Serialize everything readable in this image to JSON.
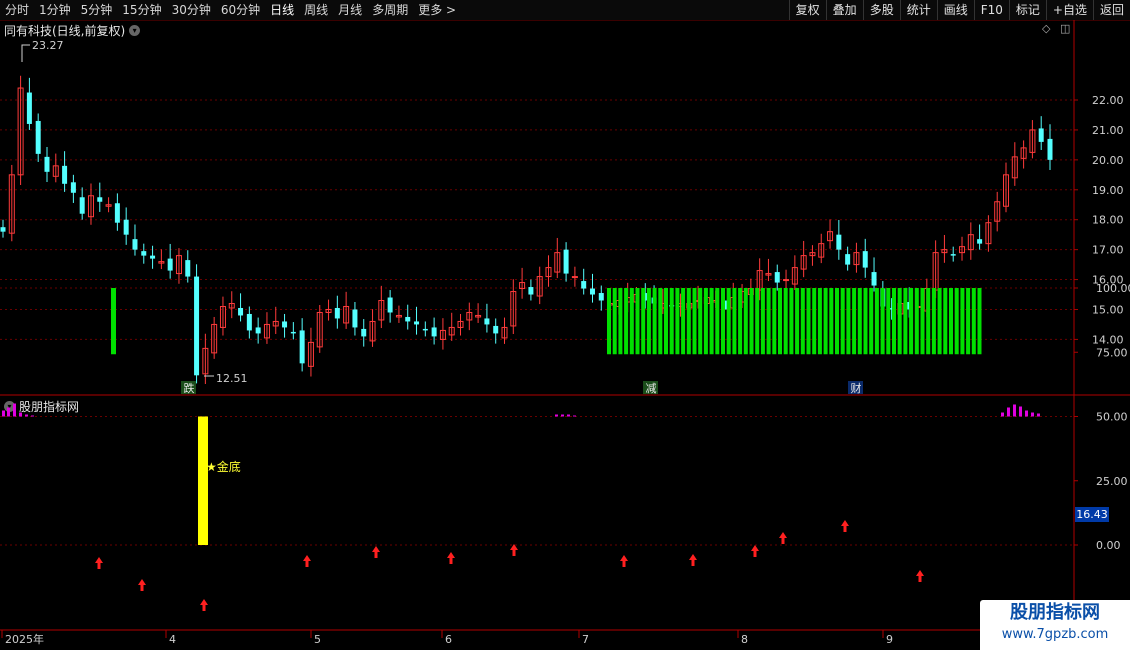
{
  "toolbar": {
    "periods": [
      "分时",
      "1分钟",
      "5分钟",
      "15分钟",
      "30分钟",
      "60分钟",
      "日线",
      "周线",
      "月线",
      "多周期",
      "更多 >"
    ],
    "active_period": "日线",
    "tools": [
      "复权",
      "叠加",
      "多股",
      "统计",
      "画线",
      "F10",
      "标记",
      "+自选",
      "返回"
    ]
  },
  "main_panel": {
    "title": "同有科技(日线,前复权)",
    "high_label": "23.27",
    "low_label": "12.51",
    "markers": [
      "跌",
      "减",
      "财"
    ]
  },
  "indicator_panel": {
    "title": "股朋指标网",
    "signal_label": "★金底",
    "current_value": "16.43"
  },
  "watermark": {
    "line1": "股朋指标网",
    "line2": "www.7gpzb.com"
  },
  "chart_data": [
    {
      "type": "candlestick",
      "title": "同有科技(日线,前复权)",
      "y_ticks": [
        14.0,
        15.0,
        16.0,
        17.0,
        18.0,
        19.0,
        20.0,
        21.0,
        22.0
      ],
      "ylim": [
        12.0,
        23.5
      ],
      "x_ticks": [
        "2025年",
        "4",
        "5",
        "6",
        "7",
        "8",
        "9"
      ],
      "grid": true,
      "annotations": {
        "max": 23.27,
        "min": 12.51
      },
      "close": [
        17.6,
        19.5,
        22.4,
        21.2,
        20.2,
        19.6,
        19.8,
        19.2,
        18.9,
        18.2,
        18.8,
        18.6,
        18.5,
        17.9,
        17.5,
        17.0,
        16.8,
        16.7,
        16.6,
        16.3,
        16.8,
        16.1,
        12.8,
        13.7,
        14.5,
        15.1,
        15.2,
        14.8,
        14.3,
        14.2,
        14.5,
        14.6,
        14.4,
        14.2,
        13.2,
        13.9,
        14.9,
        15.0,
        14.7,
        15.1,
        14.4,
        14.1,
        14.6,
        15.3,
        14.9,
        14.8,
        14.6,
        14.5,
        14.3,
        14.1,
        14.3,
        14.4,
        14.6,
        14.9,
        14.8,
        14.5,
        14.2,
        14.4,
        15.6,
        15.9,
        15.5,
        16.1,
        16.4,
        16.9,
        16.2,
        16.1,
        15.7,
        15.5,
        15.3,
        15.2,
        15.3,
        15.4,
        15.5,
        15.3,
        15.2,
        15.2,
        15.1,
        15.2,
        15.2,
        15.3,
        15.4,
        15.3,
        15.0,
        15.4,
        15.6,
        15.7,
        16.3,
        16.2,
        15.9,
        16.0,
        16.4,
        16.8,
        16.9,
        17.2,
        17.6,
        17.0,
        16.5,
        16.9,
        16.4,
        15.8,
        15.1,
        15.0,
        15.2,
        15.0,
        15.1,
        15.7,
        16.9,
        17.0,
        16.8,
        17.1,
        17.5,
        17.2,
        17.9,
        18.6,
        19.5,
        20.1,
        20.4,
        21.0,
        20.6,
        20.0
      ]
    },
    {
      "type": "bar",
      "title": "股朋指标网",
      "y_ticks": [
        0.0,
        25.0,
        50.0,
        75.0,
        100.0
      ],
      "series": [
        {
          "color": "#00e000",
          "values": []
        },
        {
          "color": "#ffff00",
          "values": [
            50
          ]
        },
        {
          "color": "#ff00ff",
          "values": []
        },
        {
          "color": "#ff2020",
          "values": []
        }
      ]
    }
  ]
}
